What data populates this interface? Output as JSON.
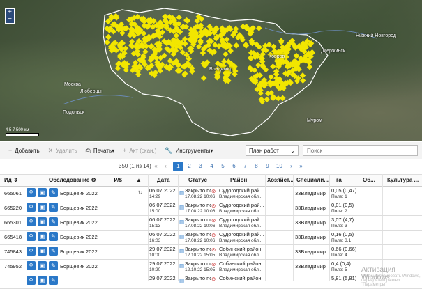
{
  "map": {
    "labels": [
      {
        "text": "Москва"
      },
      {
        "text": "Нижний Новгород"
      },
      {
        "text": "Дзержинск"
      },
      {
        "text": "Владимир"
      },
      {
        "text": "Ковров"
      },
      {
        "text": "Муром"
      },
      {
        "text": "Подольск"
      },
      {
        "text": "Люберцы"
      }
    ],
    "zoom_in": "+",
    "zoom_out": "−",
    "scale_text": "4 5 7 500 км"
  },
  "toolbar": {
    "add": "Добавить",
    "delete": "Удалить",
    "print": "Печать",
    "act": "Акт (скан.)",
    "tools": "Инструменты",
    "plan_select": "План работ",
    "search_placeholder": "Поиск"
  },
  "pager": {
    "info": "350 (1 из 14)",
    "pages": [
      "1",
      "2",
      "3",
      "4",
      "5",
      "6",
      "7",
      "8",
      "9",
      "10"
    ],
    "first": "«",
    "prev": "‹",
    "next": "›",
    "last": "»"
  },
  "table": {
    "headers": {
      "id": "Ид",
      "survey": "Обследование",
      "rub": "₽/$",
      "warn": "▲",
      "date": "Дата",
      "status": "Статус",
      "district": "Район",
      "owner": "Хозяйст...",
      "spec": "Специали...",
      "ha": "га",
      "ob": "Об...",
      "culture": "Культура ..."
    },
    "rows": [
      {
        "id": "665061",
        "survey": "Борщевик 2022",
        "date": "06.07.2022",
        "time": "14:29",
        "status": "Закрыто по...",
        "status_date": "17.08.22 10:06",
        "district": "Судогодский рай...",
        "region": "Владимирская обл...",
        "spec": "33Владимир",
        "ha": "0,05 (0,47)",
        "field": "Поле: 1"
      },
      {
        "id": "665220",
        "survey": "Борщевик 2022",
        "date": "06.07.2022",
        "time": "15:00",
        "status": "Закрыто по...",
        "status_date": "17.08.22 10:06",
        "district": "Судогодский рай...",
        "region": "Владимирская обл...",
        "spec": "33Владимир",
        "ha": "0,01 (0,5)",
        "field": "Поле: 2"
      },
      {
        "id": "665301",
        "survey": "Борщевик 2022",
        "date": "06.07.2022",
        "time": "15:13",
        "status": "Закрыто по...",
        "status_date": "17.08.22 10:06",
        "district": "Судогодский рай...",
        "region": "Владимирская обл...",
        "spec": "33Владимир",
        "ha": "3,07 (4,7)",
        "field": "Поле: 3"
      },
      {
        "id": "665418",
        "survey": "Борщевик 2022",
        "date": "06.07.2022",
        "time": "16:03",
        "status": "Закрыто по...",
        "status_date": "17.08.22 10:06",
        "district": "Судогодский рай...",
        "region": "Владимирская обл...",
        "spec": "33Владимир",
        "ha": "0,16 (0,5)",
        "field": "Поле: 3.1"
      },
      {
        "id": "745843",
        "survey": "Борщевик 2022",
        "date": "29.07.2022",
        "time": "10:00",
        "status": "Закрыто по...",
        "status_date": "12.10.22 15:05",
        "district": "Собинский район",
        "region": "Владимирская обл...",
        "spec": "33Владимир",
        "ha": "0,66 (0,66)",
        "field": "Поле: 4"
      },
      {
        "id": "745952",
        "survey": "Борщевик 2022",
        "date": "29.07.2022",
        "time": "10:20",
        "status": "Закрыто по...",
        "status_date": "12.10.22 15:05",
        "district": "Собинский район",
        "region": "Владимирская обл...",
        "spec": "33Владимир",
        "ha": "0,4 (0,4)",
        "field": "Поле: 5"
      },
      {
        "id": "",
        "survey": "",
        "date": "29.07.2022",
        "time": "",
        "status": "Закрыто по...",
        "status_date": "",
        "district": "Собинский район",
        "region": "",
        "spec": "",
        "ha": "5,81 (5,81)",
        "field": ""
      }
    ]
  },
  "watermark": "Активация Windows",
  "watermark_sub": "Чтобы активировать Windows, перейдите в раздел \"Параметры\"",
  "colors": {
    "accent": "#2a78c8",
    "marker": "#f2e600",
    "status_red": "#cc3333"
  }
}
